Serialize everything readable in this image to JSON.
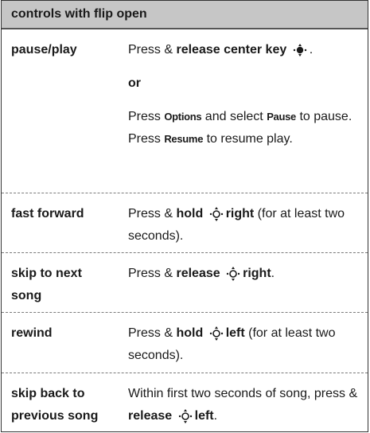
{
  "header": {
    "title": "controls with flip open"
  },
  "rows": [
    {
      "label": "pause/play",
      "press": "Press & ",
      "action": "release center key",
      "or": "or",
      "alt_press": "Press ",
      "options": "Options",
      "alt_mid": " and select ",
      "pause": "Pause",
      "alt_to": " to pause. Press ",
      "resume": "Resume",
      "alt_end": " to resume play."
    },
    {
      "label": "fast forward",
      "press": "Press & ",
      "action": "hold",
      "direction": "right",
      "tail": " (for at least two seconds)."
    },
    {
      "label": "skip to next song",
      "press": "Press & ",
      "action": "release",
      "direction": "right",
      "tail": "."
    },
    {
      "label": "rewind",
      "press": "Press & ",
      "action": "hold",
      "direction": "left",
      "tail": " (for at least two seconds)."
    },
    {
      "label": "skip back to previous song",
      "press": "Within first two seconds of song, press & ",
      "action": "release",
      "direction": "left",
      "tail": "."
    }
  ]
}
